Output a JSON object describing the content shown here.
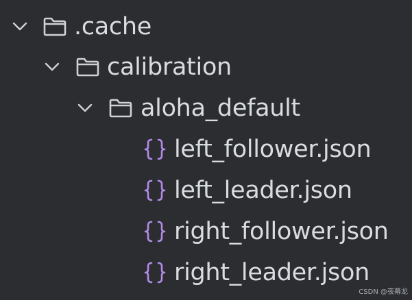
{
  "tree": {
    "items": [
      {
        "name": ".cache",
        "type": "folder",
        "expanded": true
      },
      {
        "name": "calibration",
        "type": "folder",
        "expanded": true
      },
      {
        "name": "aloha_default",
        "type": "folder",
        "expanded": true
      },
      {
        "name": "left_follower.json",
        "type": "json-file"
      },
      {
        "name": "left_leader.json",
        "type": "json-file"
      },
      {
        "name": "right_follower.json",
        "type": "json-file"
      },
      {
        "name": "right_leader.json",
        "type": "json-file"
      }
    ]
  },
  "watermark": "CSDN @夜幕龙",
  "colors": {
    "background": "#2b2d30",
    "text": "#d9dce1",
    "folder_icon": "#cfd2d6",
    "json_icon": "#b28ae8",
    "chevron": "#cfd2d6"
  },
  "icons": {
    "chevron": "chevron-down-icon",
    "folder": "folder-icon",
    "json": "json-file-icon"
  }
}
